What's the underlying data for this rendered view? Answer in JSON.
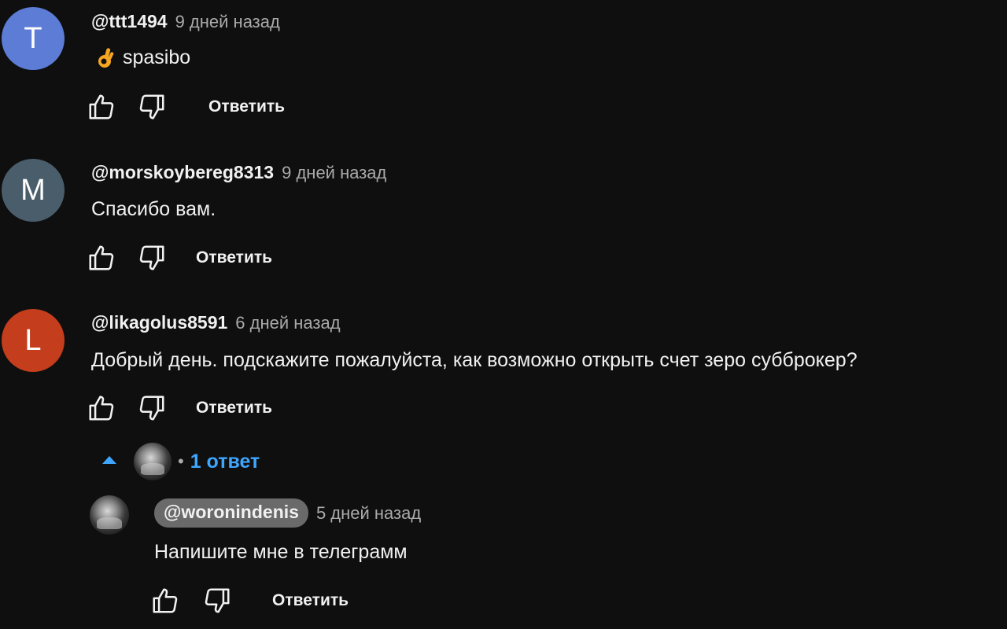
{
  "comments": [
    {
      "avatar_letter": "T",
      "avatar_color": "#5c7cd6",
      "author": "@ttt1494",
      "time": "9 дней назад",
      "emoji_icon": "ok-hand-emoji",
      "text": "spasibo",
      "reply_label": "Ответить"
    },
    {
      "avatar_letter": "M",
      "avatar_color": "#4a5d6b",
      "author": "@morskoybereg8313",
      "time": "9 дней назад",
      "text": "Спасибо вам.",
      "reply_label": "Ответить"
    },
    {
      "avatar_letter": "L",
      "avatar_color": "#c43d1c",
      "author": "@likagolus8591",
      "time": "6 дней назад",
      "text": "Добрый день. подскажите пожалуйста, как возможно открыть счет зеро субброкер?",
      "reply_label": "Ответить",
      "replies_label": "1 ответ",
      "replies_expanded": true
    }
  ],
  "reply": {
    "author": "@woronindenis",
    "time": "5 дней назад",
    "text": "Напишите мне в телеграмм",
    "reply_label": "Ответить"
  },
  "colors": {
    "background": "#0f0f0f",
    "link_blue": "#3ea6ff",
    "secondary_text": "#aaaaaa"
  }
}
